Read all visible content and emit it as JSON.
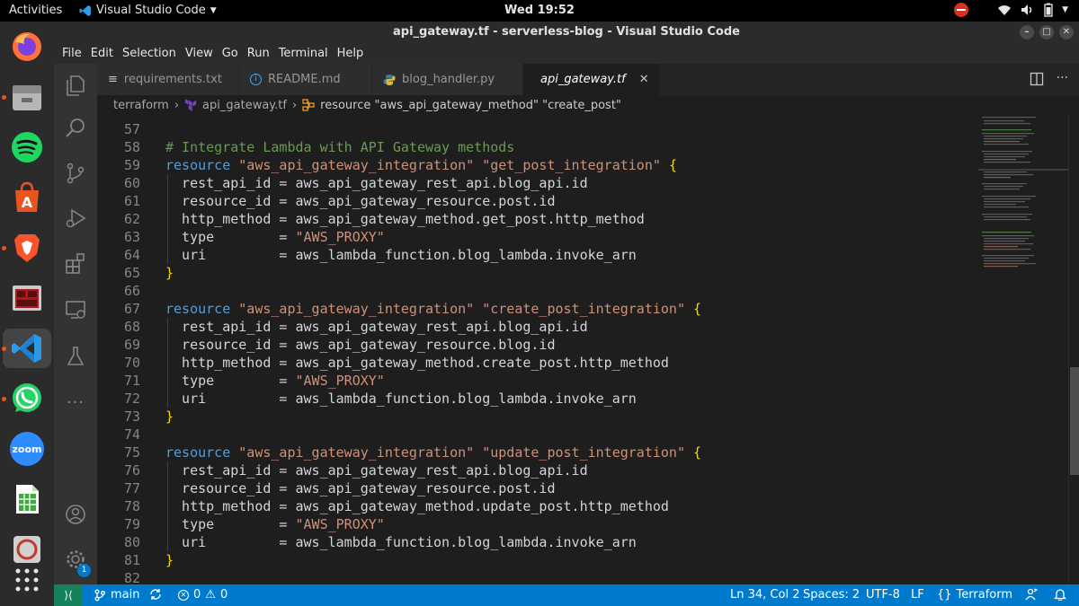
{
  "topbar": {
    "activities": "Activities",
    "app_name": "Visual Studio Code",
    "clock": "Wed 19:52"
  },
  "window": {
    "title": "api_gateway.tf - serverless-blog - Visual Studio Code"
  },
  "menu": [
    "File",
    "Edit",
    "Selection",
    "View",
    "Go",
    "Run",
    "Terminal",
    "Help"
  ],
  "tabs": [
    {
      "label": "requirements.txt",
      "icon": "list-icon"
    },
    {
      "label": "README.md",
      "icon": "info-icon"
    },
    {
      "label": "blog_handler.py",
      "icon": "python-icon"
    },
    {
      "label": "api_gateway.tf",
      "icon": "terraform-icon",
      "active": true
    }
  ],
  "breadcrumb": {
    "folder": "terraform",
    "file": "api_gateway.tf",
    "symbol": "resource \"aws_api_gateway_method\" \"create_post\""
  },
  "code_lines": [
    {
      "n": "57",
      "segments": []
    },
    {
      "n": "58",
      "segments": [
        {
          "t": "# Integrate Lambda with API Gateway methods",
          "c": "comment"
        }
      ]
    },
    {
      "n": "59",
      "segments": [
        {
          "t": "resource ",
          "c": "kw"
        },
        {
          "t": "\"aws_api_gateway_integration\"",
          "c": "str"
        },
        {
          "t": " "
        },
        {
          "t": "\"get_post_integration\"",
          "c": "str"
        },
        {
          "t": " "
        },
        {
          "t": "{",
          "c": "brace"
        }
      ]
    },
    {
      "n": "60",
      "segments": [
        {
          "t": "  rest_api_id = aws_api_gateway_rest_api.blog_api.id"
        }
      ]
    },
    {
      "n": "61",
      "segments": [
        {
          "t": "  resource_id = aws_api_gateway_resource.post.id"
        }
      ]
    },
    {
      "n": "62",
      "segments": [
        {
          "t": "  http_method = aws_api_gateway_method.get_post.http_method"
        }
      ]
    },
    {
      "n": "63",
      "segments": [
        {
          "t": "  type        = "
        },
        {
          "t": "\"AWS_PROXY\"",
          "c": "str"
        }
      ]
    },
    {
      "n": "64",
      "segments": [
        {
          "t": "  uri         = aws_lambda_function.blog_lambda.invoke_arn"
        }
      ]
    },
    {
      "n": "65",
      "segments": [
        {
          "t": "}",
          "c": "brace"
        }
      ]
    },
    {
      "n": "66",
      "segments": []
    },
    {
      "n": "67",
      "segments": [
        {
          "t": "resource ",
          "c": "kw"
        },
        {
          "t": "\"aws_api_gateway_integration\"",
          "c": "str"
        },
        {
          "t": " "
        },
        {
          "t": "\"create_post_integration\"",
          "c": "str"
        },
        {
          "t": " "
        },
        {
          "t": "{",
          "c": "brace"
        }
      ]
    },
    {
      "n": "68",
      "segments": [
        {
          "t": "  rest_api_id = aws_api_gateway_rest_api.blog_api.id"
        }
      ]
    },
    {
      "n": "69",
      "segments": [
        {
          "t": "  resource_id = aws_api_gateway_resource.blog.id"
        }
      ]
    },
    {
      "n": "70",
      "segments": [
        {
          "t": "  http_method = aws_api_gateway_method.create_post.http_method"
        }
      ]
    },
    {
      "n": "71",
      "segments": [
        {
          "t": "  type        = "
        },
        {
          "t": "\"AWS_PROXY\"",
          "c": "str"
        }
      ]
    },
    {
      "n": "72",
      "segments": [
        {
          "t": "  uri         = aws_lambda_function.blog_lambda.invoke_arn"
        }
      ]
    },
    {
      "n": "73",
      "segments": [
        {
          "t": "}",
          "c": "brace"
        }
      ]
    },
    {
      "n": "74",
      "segments": []
    },
    {
      "n": "75",
      "segments": [
        {
          "t": "resource ",
          "c": "kw"
        },
        {
          "t": "\"aws_api_gateway_integration\"",
          "c": "str"
        },
        {
          "t": " "
        },
        {
          "t": "\"update_post_integration\"",
          "c": "str"
        },
        {
          "t": " "
        },
        {
          "t": "{",
          "c": "brace"
        }
      ]
    },
    {
      "n": "76",
      "segments": [
        {
          "t": "  rest_api_id = aws_api_gateway_rest_api.blog_api.id"
        }
      ]
    },
    {
      "n": "77",
      "segments": [
        {
          "t": "  resource_id = aws_api_gateway_resource.post.id"
        }
      ]
    },
    {
      "n": "78",
      "segments": [
        {
          "t": "  http_method = aws_api_gateway_method.update_post.http_method"
        }
      ]
    },
    {
      "n": "79",
      "segments": [
        {
          "t": "  type        = "
        },
        {
          "t": "\"AWS_PROXY\"",
          "c": "str"
        }
      ]
    },
    {
      "n": "80",
      "segments": [
        {
          "t": "  uri         = aws_lambda_function.blog_lambda.invoke_arn"
        }
      ]
    },
    {
      "n": "81",
      "segments": [
        {
          "t": "}",
          "c": "brace"
        }
      ]
    },
    {
      "n": "82",
      "segments": []
    }
  ],
  "status": {
    "branch": "main",
    "errors": "0",
    "warnings": "0",
    "position": "Ln 34, Col 2",
    "spaces": "Spaces: 2",
    "encoding": "UTF-8",
    "eol": "LF",
    "language": "Terraform"
  },
  "activity_badge": "1",
  "dock": [
    "firefox-icon",
    "files-icon",
    "spotify-icon",
    "software-icon",
    "brave-icon",
    "terminal-app-icon",
    "vscode-icon",
    "whatsapp-icon",
    "zoom-icon",
    "spreadsheet-icon",
    "disc-icon",
    "app-grid-icon"
  ],
  "dock_zoom_label": "zoom",
  "colors": {
    "accent": "#007acc",
    "remote": "#16825d",
    "comment": "#6a9955",
    "keyword": "#569cd6",
    "string": "#ce9178",
    "brace": "#ffd700"
  }
}
